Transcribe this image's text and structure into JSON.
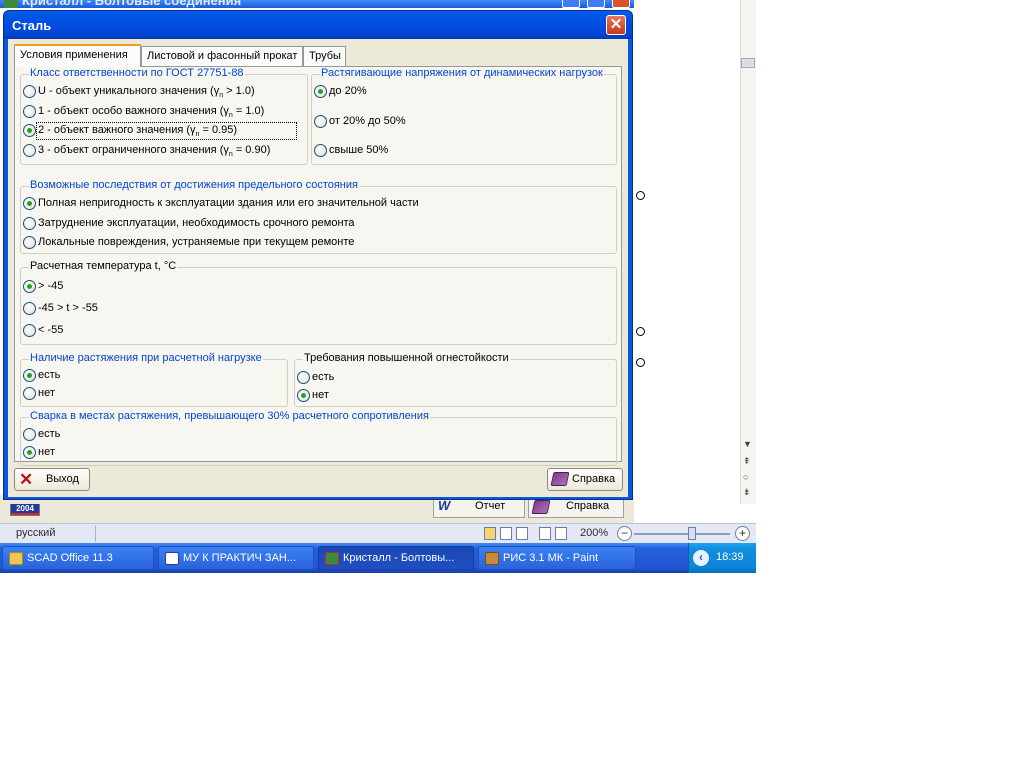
{
  "background_app": {
    "title": "Кристалл - Болтовые соединения",
    "buttons": {
      "report": "Отчет",
      "help": "Справка"
    },
    "logo_text": "2004"
  },
  "statusbar": {
    "language": "русский",
    "zoom": "200%"
  },
  "taskbar": {
    "items": [
      {
        "label": "SCAD Office 11.3",
        "icon": "folder-icon"
      },
      {
        "label": "МУ К ПРАКТИЧ ЗАН...",
        "icon": "word-doc-icon"
      },
      {
        "label": "Кристалл - Болтовы...",
        "icon": "kristall-app-icon",
        "active": true
      },
      {
        "label": "РИС 3.1 МК - Paint",
        "icon": "paint-icon"
      }
    ],
    "clock": "18:39"
  },
  "dialog": {
    "title": "Сталь",
    "tabs": [
      {
        "label": "Условия применения",
        "active": true
      },
      {
        "label": "Листовой и фасонный прокат",
        "active": false
      },
      {
        "label": "Трубы",
        "active": false
      }
    ],
    "groups": {
      "responsibility": {
        "title": "Класс ответственности по ГОСТ 27751-88",
        "options": [
          {
            "prefix": "U - объект уникального значения (γ",
            "sub": "n",
            "suffix": " > 1.0)",
            "checked": false
          },
          {
            "prefix": "1 - объект особо важного значения (γ",
            "sub": "n",
            "suffix": " = 1.0)",
            "checked": false
          },
          {
            "prefix": "2 - объект важного значения (γ",
            "sub": "n",
            "suffix": " = 0.95)",
            "checked": true
          },
          {
            "prefix": "3 - объект ограниченного значения (γ",
            "sub": "n",
            "suffix": " = 0.90)",
            "checked": false
          }
        ]
      },
      "dynamic_stress": {
        "title": "Растягивающие напряжения от динамических нагрузок",
        "options": [
          {
            "label": "до 20%",
            "checked": true
          },
          {
            "label": "от 20% до 50%",
            "checked": false
          },
          {
            "label": "свыше 50%",
            "checked": false
          }
        ]
      },
      "consequences": {
        "title": "Возможные последствия от достижения предельного состояния",
        "options": [
          {
            "label": "Полная непригодность к эксплуатации здания или его значительной части",
            "checked": true
          },
          {
            "label": "Затруднение эксплуатации, необходимость срочного ремонта",
            "checked": false
          },
          {
            "label": "Локальные повреждения, устраняемые при текущем ремонте",
            "checked": false
          }
        ]
      },
      "temperature": {
        "title": "Расчетная температура t, °C",
        "options": [
          {
            "label": "> -45",
            "checked": true
          },
          {
            "label": "-45 > t > -55",
            "checked": false
          },
          {
            "label": "< -55",
            "checked": false
          }
        ]
      },
      "tension": {
        "title": "Наличие растяжения при расчетной нагрузке",
        "options": [
          {
            "label": "есть",
            "checked": true
          },
          {
            "label": "нет",
            "checked": false
          }
        ]
      },
      "fire_resistance": {
        "title": "Требования повышенной огнестойкости",
        "options": [
          {
            "label": "есть",
            "checked": false
          },
          {
            "label": "нет",
            "checked": true
          }
        ]
      },
      "welding": {
        "title": "Сварка в местах растяжения, превышающего 30% расчетного сопротивления",
        "options": [
          {
            "label": "есть",
            "checked": false
          },
          {
            "label": "нет",
            "checked": true
          }
        ]
      }
    },
    "buttons": {
      "exit": "Выход",
      "help": "Справка"
    }
  }
}
